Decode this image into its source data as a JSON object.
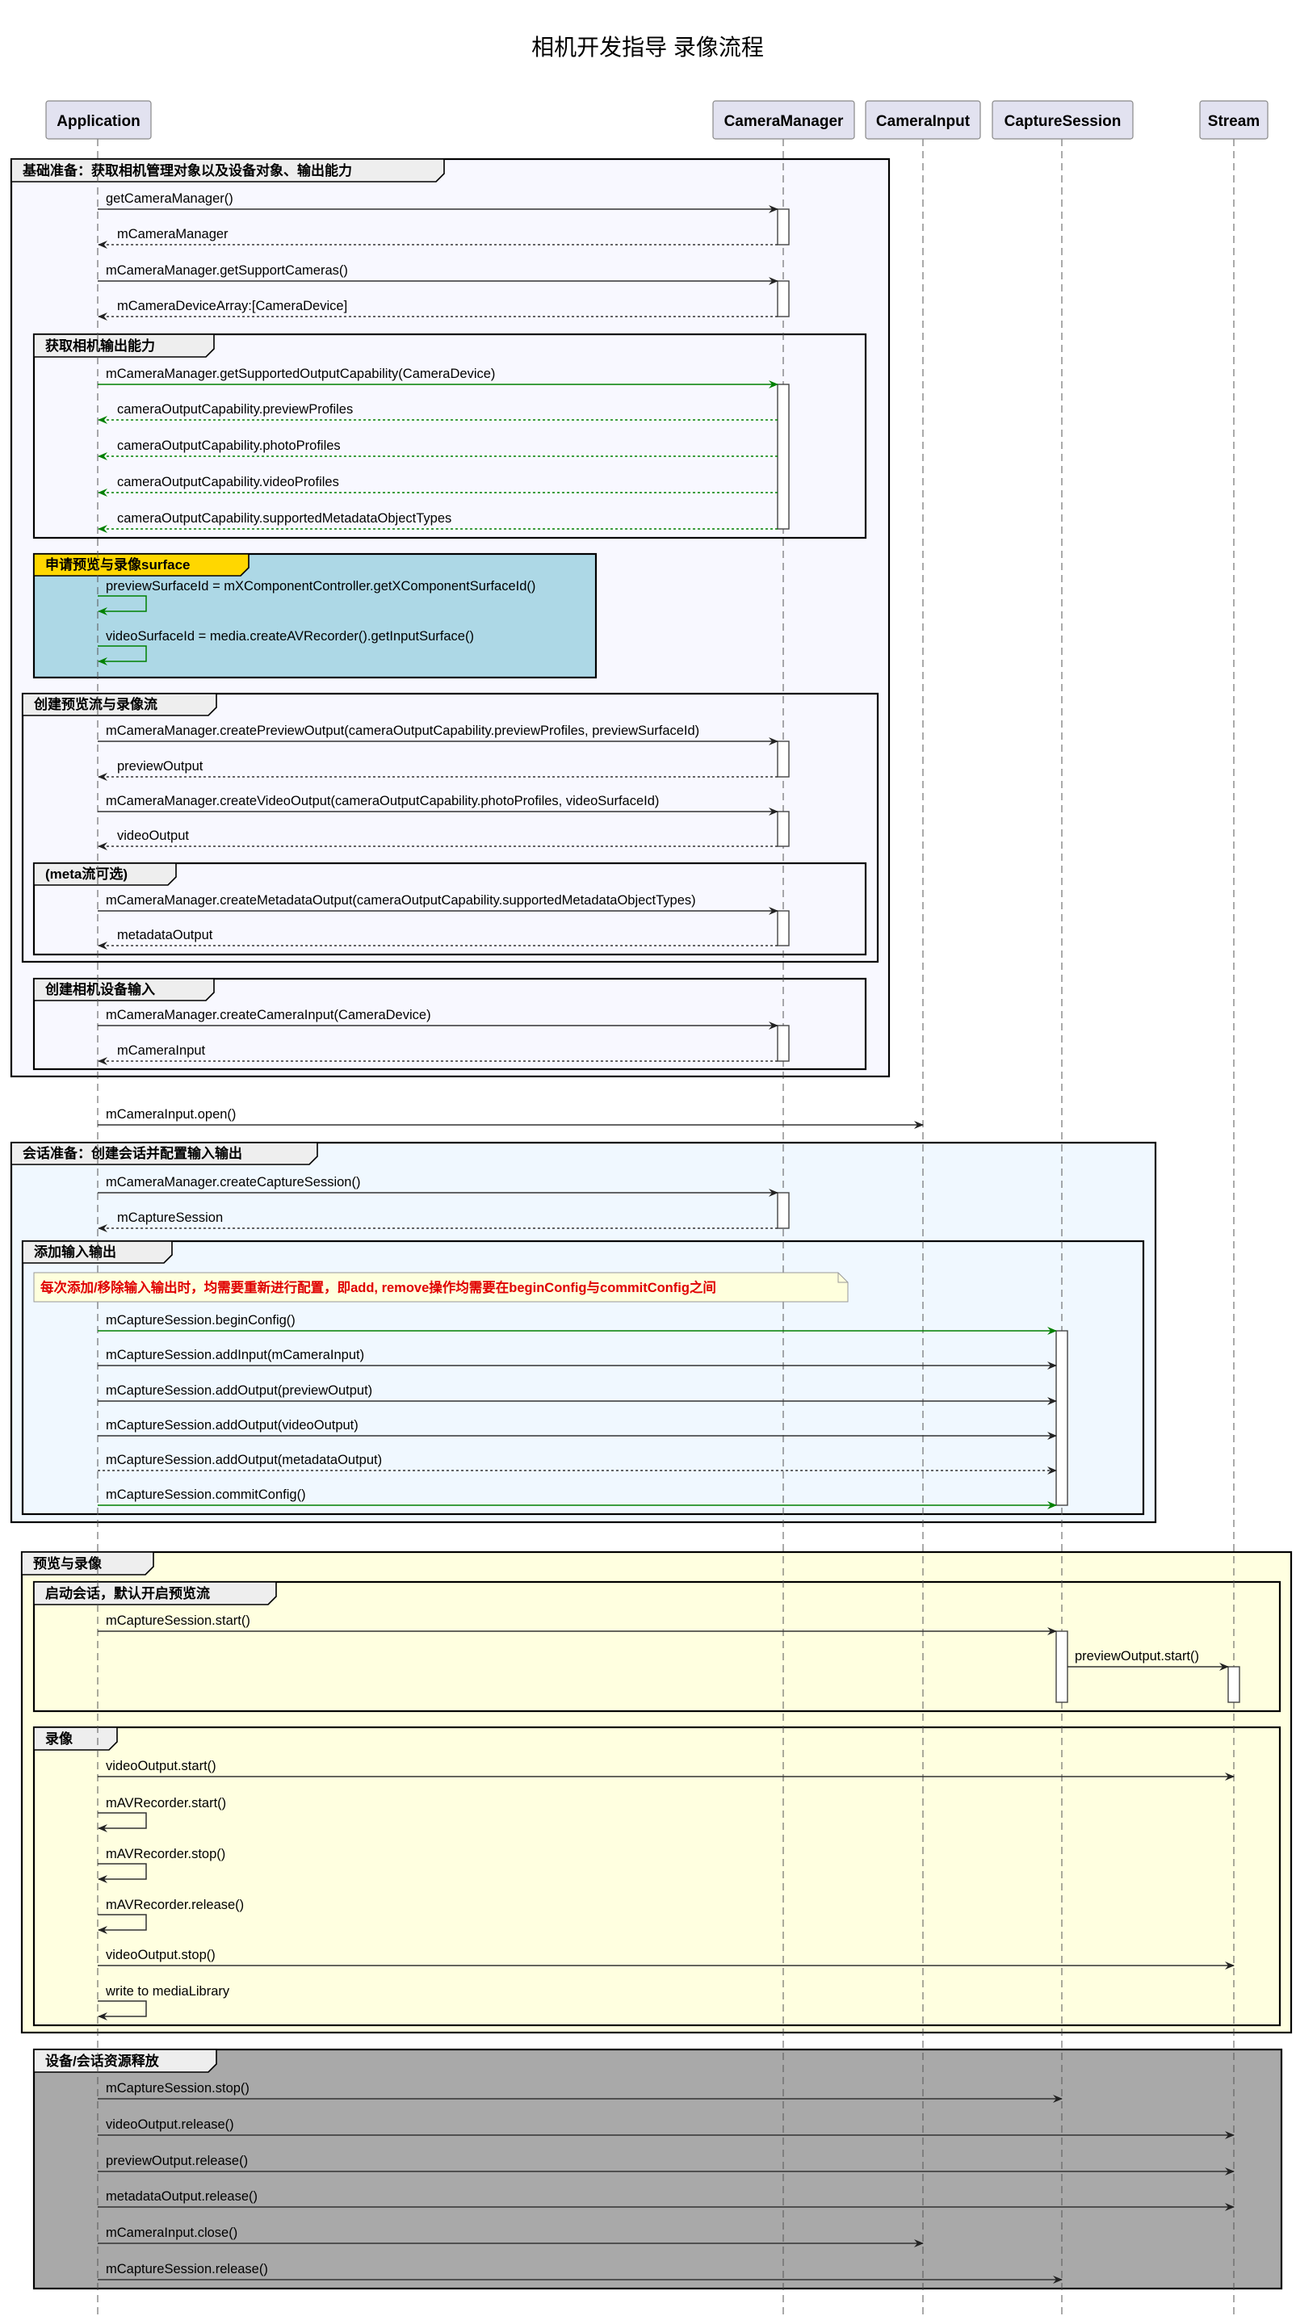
{
  "title": "相机开发指导 录像流程",
  "colors": {
    "default_arrow": "#333333",
    "green_arrow": "#008000",
    "frame_base": "#F8F8FF",
    "frame_session": "#F0F8FF",
    "frame_surface": "#ADD8E6",
    "frame_surface_tab": "#FFD700",
    "frame_preview": "#FFFFE0",
    "frame_release": "#A9A9A9",
    "note_text": "#E00000"
  },
  "participants": [
    {
      "id": "app",
      "label": "Application"
    },
    {
      "id": "cm",
      "label": "CameraManager"
    },
    {
      "id": "ci",
      "label": "CameraInput"
    },
    {
      "id": "cs",
      "label": "CaptureSession"
    },
    {
      "id": "st",
      "label": "Stream"
    }
  ],
  "frames": [
    {
      "id": "f_base",
      "label": "基础准备：获取相机管理对象以及设备对象、输出能力",
      "style": "base"
    },
    {
      "id": "f_cap",
      "label": "获取相机输出能力",
      "style": "base"
    },
    {
      "id": "f_surface",
      "label": "申请预览与录像surface",
      "style": "surface"
    },
    {
      "id": "f_create",
      "label": "创建预览流与录像流",
      "style": "base"
    },
    {
      "id": "f_meta",
      "label": "(meta流可选)",
      "style": "base"
    },
    {
      "id": "f_input",
      "label": "创建相机设备输入",
      "style": "base"
    },
    {
      "id": "f_session",
      "label": "会话准备：创建会话并配置输入输出",
      "style": "session"
    },
    {
      "id": "f_addio",
      "label": "添加输入输出",
      "style": "session"
    },
    {
      "id": "f_preview",
      "label": "预览与录像",
      "style": "preview"
    },
    {
      "id": "f_start",
      "label": "启动会话，默认开启预览流",
      "style": "preview"
    },
    {
      "id": "f_record",
      "label": "录像",
      "style": "preview"
    },
    {
      "id": "f_release",
      "label": "设备/会话资源释放",
      "style": "release"
    }
  ],
  "note": {
    "text": "每次添加/移除输入输出时，均需要重新进行配置，即add, remove操作均需要在beginConfig与commitConfig之间"
  },
  "messages": [
    {
      "from": "app",
      "to": "cm",
      "label": "getCameraManager()",
      "kind": "sync",
      "color": "default"
    },
    {
      "from": "cm",
      "to": "app",
      "label": "mCameraManager",
      "kind": "return",
      "color": "default"
    },
    {
      "from": "app",
      "to": "cm",
      "label": "mCameraManager.getSupportCameras()",
      "kind": "sync",
      "color": "default"
    },
    {
      "from": "cm",
      "to": "app",
      "label": "mCameraDeviceArray:[CameraDevice]",
      "kind": "return",
      "color": "default"
    },
    {
      "from": "app",
      "to": "cm",
      "label": "mCameraManager.getSupportedOutputCapability(CameraDevice)",
      "kind": "sync",
      "color": "green"
    },
    {
      "from": "cm",
      "to": "app",
      "label": "cameraOutputCapability.previewProfiles",
      "kind": "return",
      "color": "green"
    },
    {
      "from": "cm",
      "to": "app",
      "label": "cameraOutputCapability.photoProfiles",
      "kind": "return",
      "color": "green"
    },
    {
      "from": "cm",
      "to": "app",
      "label": "cameraOutputCapability.videoProfiles",
      "kind": "return",
      "color": "green"
    },
    {
      "from": "cm",
      "to": "app",
      "label": "cameraOutputCapability.supportedMetadataObjectTypes",
      "kind": "return",
      "color": "green"
    },
    {
      "from": "app",
      "to": "app",
      "label": "previewSurfaceId = mXComponentController.getXComponentSurfaceId()",
      "kind": "self",
      "color": "green"
    },
    {
      "from": "app",
      "to": "app",
      "label": "videoSurfaceId = media.createAVRecorder().getInputSurface()",
      "kind": "self",
      "color": "green"
    },
    {
      "from": "app",
      "to": "cm",
      "label": "mCameraManager.createPreviewOutput(cameraOutputCapability.previewProfiles, previewSurfaceId)",
      "kind": "sync",
      "color": "default"
    },
    {
      "from": "cm",
      "to": "app",
      "label": "previewOutput",
      "kind": "return",
      "color": "default"
    },
    {
      "from": "app",
      "to": "cm",
      "label": "mCameraManager.createVideoOutput(cameraOutputCapability.photoProfiles, videoSurfaceId)",
      "kind": "sync",
      "color": "default"
    },
    {
      "from": "cm",
      "to": "app",
      "label": "videoOutput",
      "kind": "return",
      "color": "default"
    },
    {
      "from": "app",
      "to": "cm",
      "label": "mCameraManager.createMetadataOutput(cameraOutputCapability.supportedMetadataObjectTypes)",
      "kind": "sync",
      "color": "default"
    },
    {
      "from": "cm",
      "to": "app",
      "label": "metadataOutput",
      "kind": "return",
      "color": "default"
    },
    {
      "from": "app",
      "to": "cm",
      "label": "mCameraManager.createCameraInput(CameraDevice)",
      "kind": "sync",
      "color": "default"
    },
    {
      "from": "cm",
      "to": "app",
      "label": "mCameraInput",
      "kind": "return",
      "color": "default"
    },
    {
      "from": "app",
      "to": "ci",
      "label": "mCameraInput.open()",
      "kind": "sync",
      "color": "default"
    },
    {
      "from": "app",
      "to": "cm",
      "label": "mCameraManager.createCaptureSession()",
      "kind": "sync",
      "color": "default"
    },
    {
      "from": "cm",
      "to": "app",
      "label": "mCaptureSession",
      "kind": "return",
      "color": "default"
    },
    {
      "from": "app",
      "to": "cs",
      "label": "mCaptureSession.beginConfig()",
      "kind": "sync",
      "color": "green"
    },
    {
      "from": "app",
      "to": "cs",
      "label": "mCaptureSession.addInput(mCameraInput)",
      "kind": "sync",
      "color": "default"
    },
    {
      "from": "app",
      "to": "cs",
      "label": "mCaptureSession.addOutput(previewOutput)",
      "kind": "sync",
      "color": "default"
    },
    {
      "from": "app",
      "to": "cs",
      "label": "mCaptureSession.addOutput(videoOutput)",
      "kind": "sync",
      "color": "default"
    },
    {
      "from": "app",
      "to": "cs",
      "label": "mCaptureSession.addOutput(metadataOutput)",
      "kind": "dashed",
      "color": "default"
    },
    {
      "from": "app",
      "to": "cs",
      "label": "mCaptureSession.commitConfig()",
      "kind": "sync",
      "color": "green"
    },
    {
      "from": "app",
      "to": "cs",
      "label": "mCaptureSession.start()",
      "kind": "sync",
      "color": "default"
    },
    {
      "from": "cs",
      "to": "st",
      "label": "previewOutput.start()",
      "kind": "sync",
      "color": "default"
    },
    {
      "from": "app",
      "to": "st",
      "label": "videoOutput.start()",
      "kind": "sync",
      "color": "default"
    },
    {
      "from": "app",
      "to": "app",
      "label": "mAVRecorder.start()",
      "kind": "self",
      "color": "default"
    },
    {
      "from": "app",
      "to": "app",
      "label": "mAVRecorder.stop()",
      "kind": "self",
      "color": "default"
    },
    {
      "from": "app",
      "to": "app",
      "label": "mAVRecorder.release()",
      "kind": "self",
      "color": "default"
    },
    {
      "from": "app",
      "to": "st",
      "label": "videoOutput.stop()",
      "kind": "sync",
      "color": "default"
    },
    {
      "from": "app",
      "to": "app",
      "label": "write to mediaLibrary",
      "kind": "self",
      "color": "default"
    },
    {
      "from": "app",
      "to": "cs",
      "label": "mCaptureSession.stop()",
      "kind": "sync",
      "color": "default"
    },
    {
      "from": "app",
      "to": "st",
      "label": "videoOutput.release()",
      "kind": "sync",
      "color": "default"
    },
    {
      "from": "app",
      "to": "st",
      "label": "previewOutput.release()",
      "kind": "sync",
      "color": "default"
    },
    {
      "from": "app",
      "to": "st",
      "label": "metadataOutput.release()",
      "kind": "sync",
      "color": "default"
    },
    {
      "from": "app",
      "to": "ci",
      "label": "mCameraInput.close()",
      "kind": "sync",
      "color": "default"
    },
    {
      "from": "app",
      "to": "cs",
      "label": "mCaptureSession.release()",
      "kind": "sync",
      "color": "default"
    }
  ]
}
